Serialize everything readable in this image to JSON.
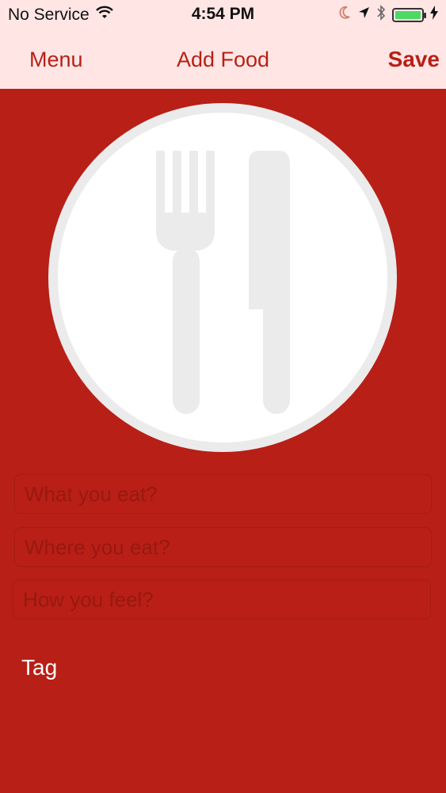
{
  "status_bar": {
    "carrier": "No Service",
    "time": "4:54 PM",
    "icons": [
      "wifi-icon",
      "moon-icon",
      "location-arrow-icon",
      "bluetooth-icon",
      "battery-icon",
      "charging-bolt-icon"
    ],
    "battery_level": 1.0,
    "battery_color": "#4cd964"
  },
  "nav": {
    "left_label": "Menu",
    "title": "Add Food",
    "right_label": "Save"
  },
  "photo": {
    "icon": "fork-knife-icon"
  },
  "form": {
    "what_placeholder": "What you eat?",
    "where_placeholder": "Where you eat?",
    "feel_placeholder": "How you feel?"
  },
  "tag_label": "Tag",
  "colors": {
    "background": "#b81f16",
    "nav_background": "#ffe6e4",
    "accent": "#b81f16"
  }
}
